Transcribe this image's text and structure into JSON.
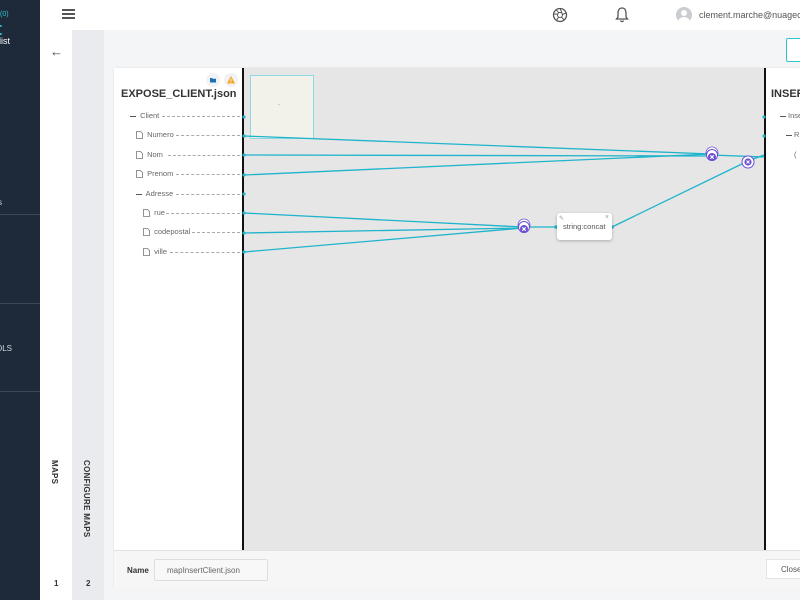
{
  "sidebar": {
    "logo_top": "(0)",
    "logo_main": "t",
    "role": "ialist",
    "items": [
      "s",
      "OLS"
    ]
  },
  "topbar": {
    "menu_icon": "hamburger-icon",
    "icons": [
      "aperture-icon",
      "bell-icon"
    ],
    "user_email": "clement.marche@nuageo.f"
  },
  "steps": {
    "back_icon": "arrow-left-icon",
    "items": [
      {
        "label": "MAPS",
        "number": "1"
      },
      {
        "label": "CONFIGURE MAPS",
        "number": "2"
      }
    ]
  },
  "colors": {
    "accent": "#2ec5d3",
    "wire": "#1fb4cc",
    "node": "#6a4fd0",
    "sidebar": "#1e2a3a",
    "warning": "#f5a623",
    "folder": "#1a6fb5"
  },
  "source": {
    "title": "EXPOSE_CLIENT.json",
    "badges": [
      "folder-icon",
      "warning-icon"
    ],
    "items": [
      {
        "label": "Client",
        "type": "object"
      },
      {
        "label": "Numero",
        "type": "file"
      },
      {
        "label": "Nom",
        "type": "file"
      },
      {
        "label": "Prenom",
        "type": "file"
      },
      {
        "label": "Adresse",
        "type": "object"
      },
      {
        "label": "rue",
        "type": "file"
      },
      {
        "label": "codepostal",
        "type": "file"
      },
      {
        "label": "ville",
        "type": "file"
      }
    ]
  },
  "canvas": {
    "minimap_label": "-",
    "function": {
      "label": "string:concat"
    }
  },
  "target": {
    "title": "INSER",
    "items": [
      "Inse",
      "R",
      "("
    ]
  },
  "footer": {
    "name_label": "Name",
    "name_value": "mapInsertClient.json",
    "close_label": "Close"
  }
}
